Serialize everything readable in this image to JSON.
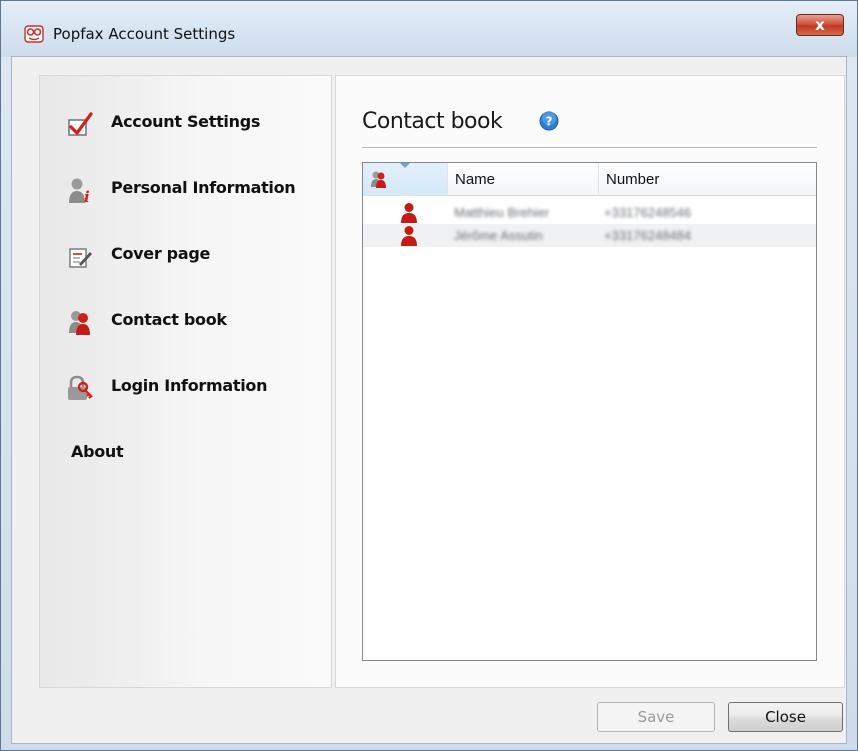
{
  "window": {
    "title": "Popfax Account Settings",
    "close_glyph": "x",
    "colors": {
      "frame": "#cfdcec",
      "close": "#c03a22",
      "accent_red": "#d0201a"
    }
  },
  "sidebar": {
    "items": [
      {
        "label": "Account Settings",
        "icon": "checkbox-check-icon"
      },
      {
        "label": "Personal Information",
        "icon": "person-info-icon"
      },
      {
        "label": "Cover page",
        "icon": "cover-page-icon"
      },
      {
        "label": "Contact book",
        "icon": "contacts-icon",
        "selected": true
      },
      {
        "label": "Login Information",
        "icon": "login-key-icon"
      },
      {
        "label": "About",
        "icon": ""
      }
    ]
  },
  "content": {
    "title": "Contact book",
    "help_icon": "help-icon",
    "table": {
      "columns": [
        "",
        "Name",
        "Number"
      ],
      "rows": [
        {
          "name": "Matthieu Brehier",
          "number": "+33176248546"
        },
        {
          "name": "Jérôme Assutin",
          "number": "+33176248484"
        }
      ]
    }
  },
  "buttons": {
    "save_label": "Save",
    "save_enabled": false,
    "close_label": "Close"
  }
}
